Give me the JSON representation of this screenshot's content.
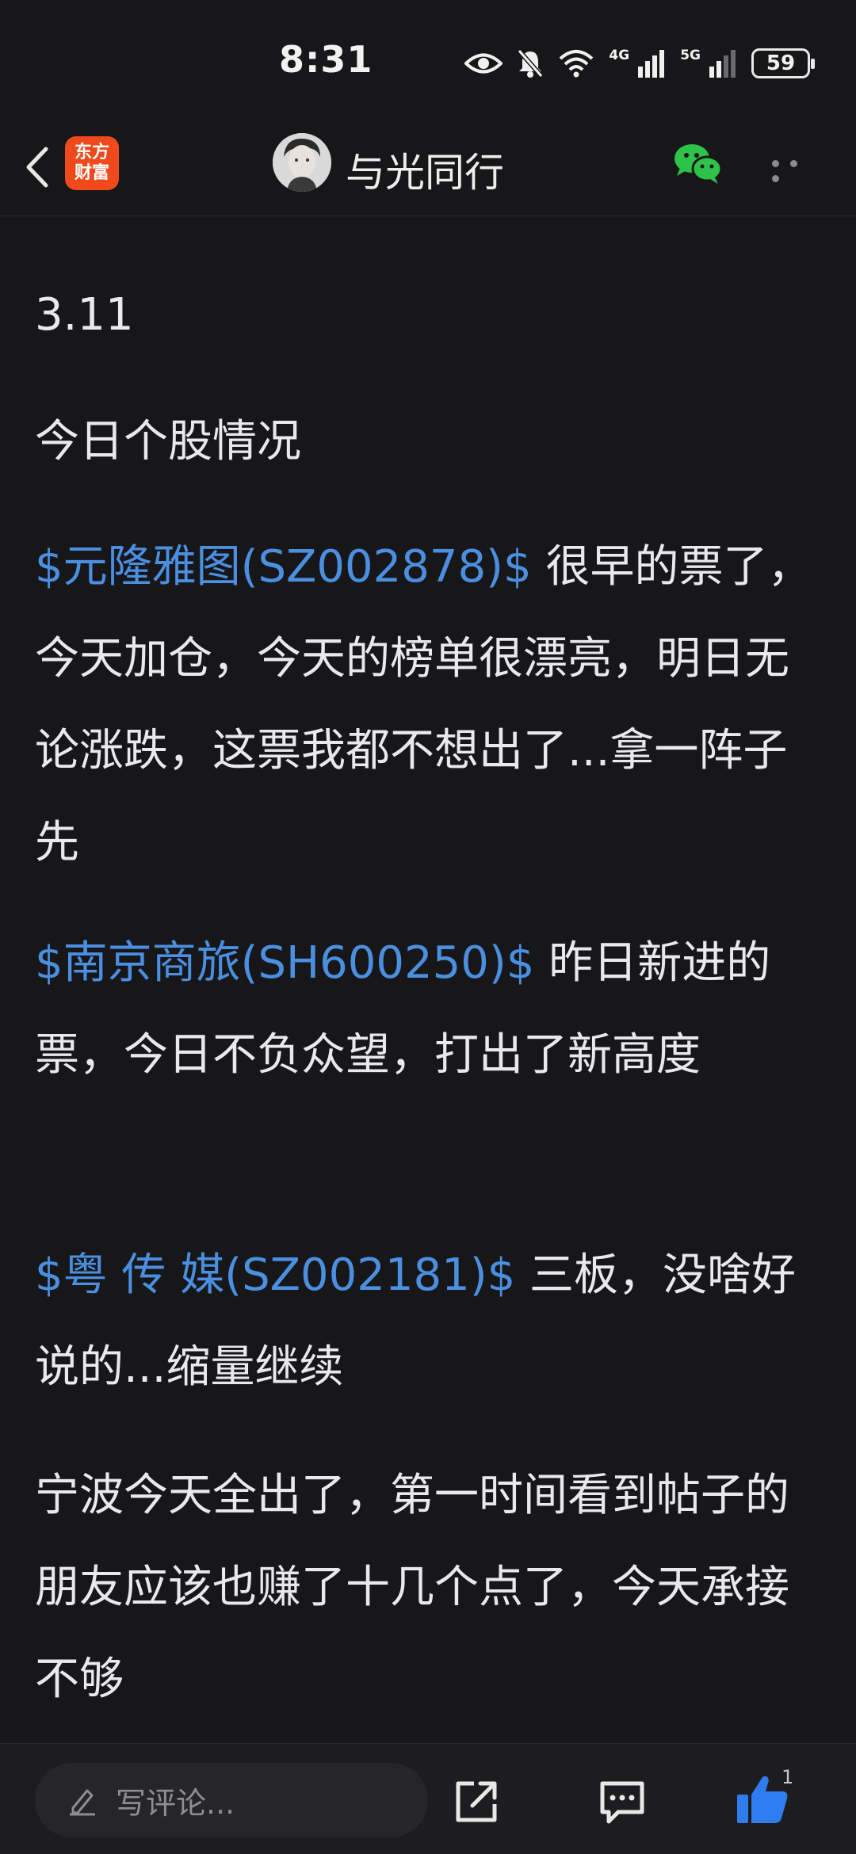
{
  "status_bar": {
    "time": "8:31",
    "net1": "4G",
    "net2": "5G",
    "battery": "59"
  },
  "nav": {
    "logo_line1": "东方",
    "logo_line2": "财富",
    "title": "与光同行"
  },
  "post": {
    "date": "3.11",
    "heading": "今日个股情况",
    "items": [
      {
        "stock": "$元隆雅图(SZ002878)$",
        "text": " 很早的票了，今天加仓，今天的榜单很漂亮，明日无论涨跌，这票我都不想出了...拿一阵子先"
      },
      {
        "stock": "$南京商旅(SH600250)$",
        "text": " 昨日新进的票，今日不负众望，打出了新高度"
      },
      {
        "stock": "$粤 传 媒(SZ002181)$",
        "text": " 三板，没啥好说的...缩量继续"
      }
    ],
    "closing": "宁波今天全出了，第一时间看到帖子的朋友应该也赚了十几个点了，今天承接不够"
  },
  "bottom_bar": {
    "comment_placeholder": "写评论...",
    "like_count": "1"
  },
  "colors": {
    "background": "#17171a",
    "link": "#4a8fe0",
    "like": "#2f7bf0",
    "logo": "#f04a1c",
    "wechat": "#2dc24a"
  }
}
